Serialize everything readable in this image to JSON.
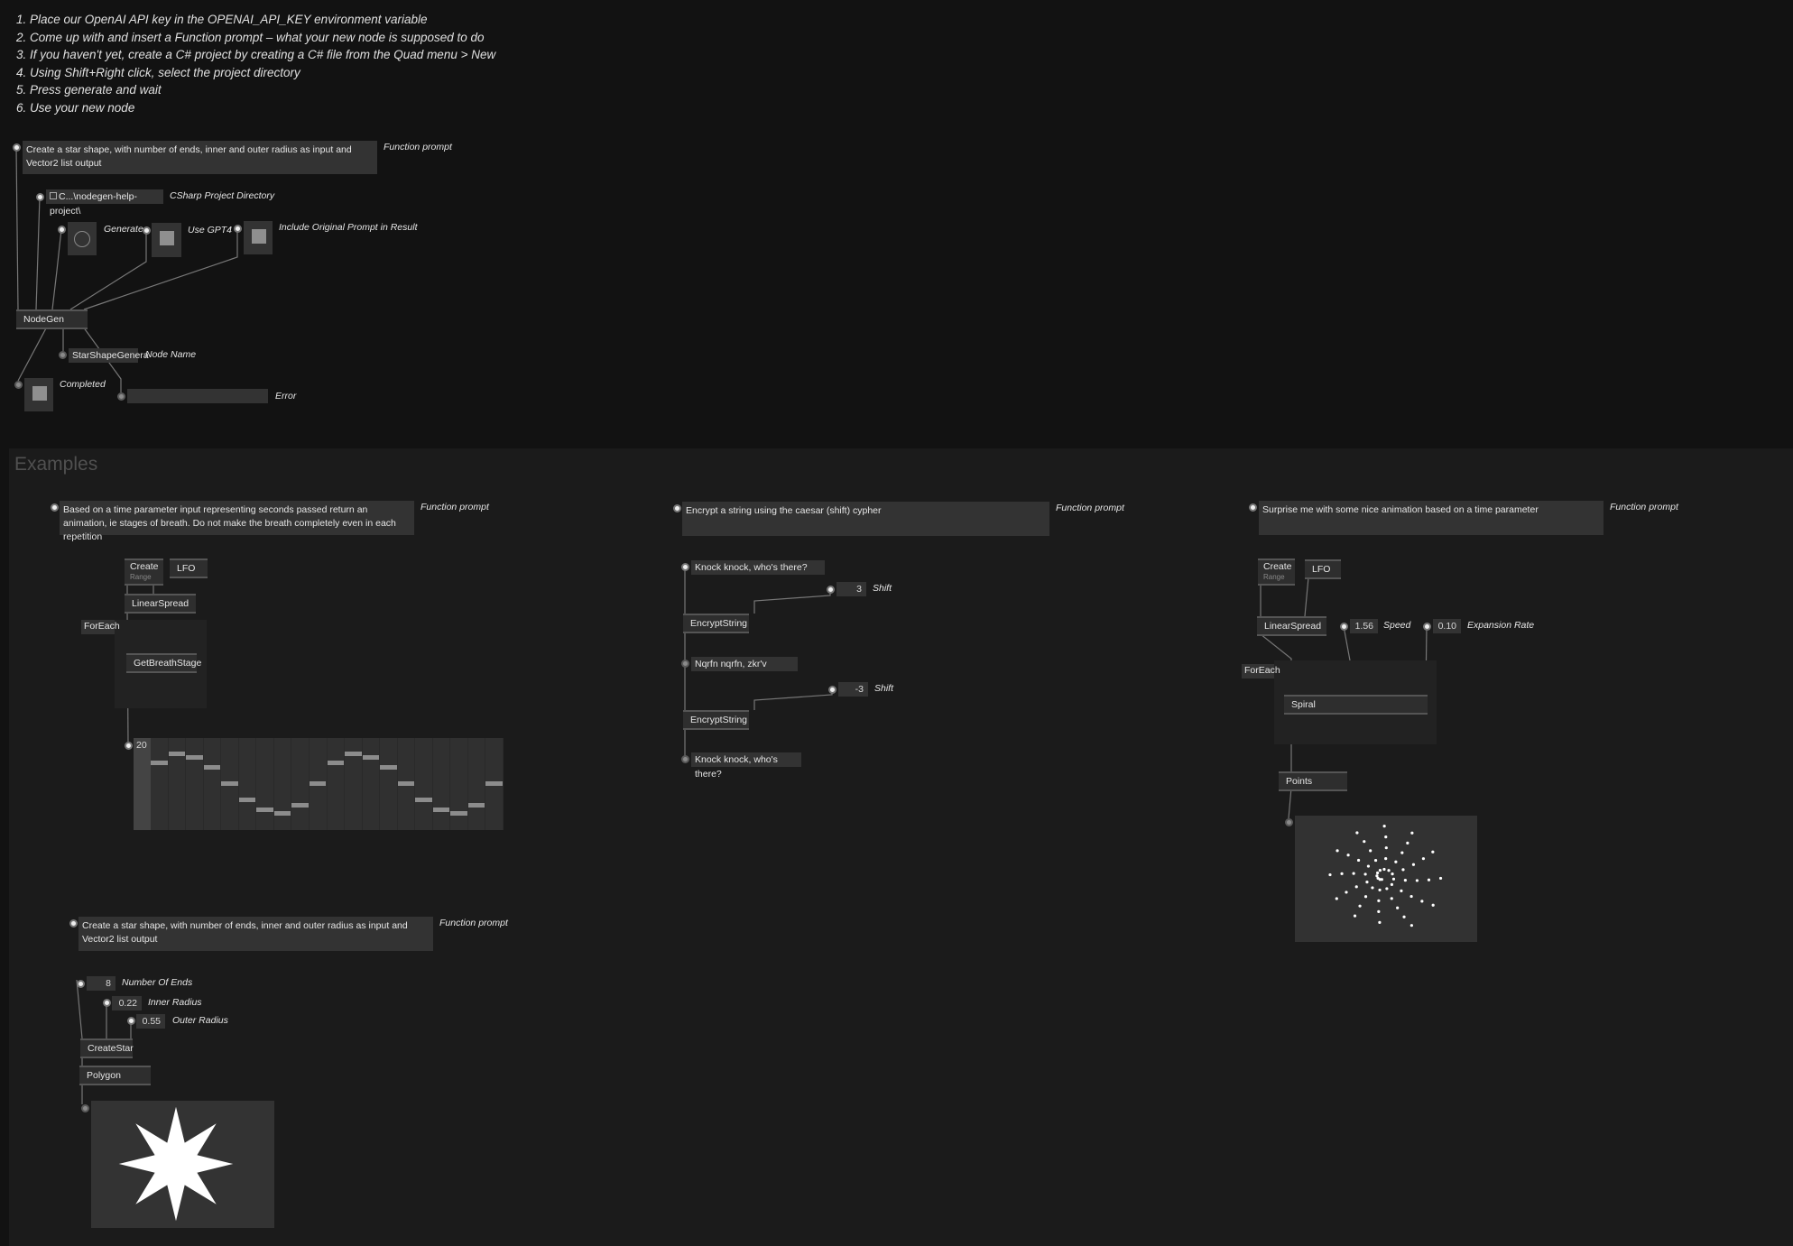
{
  "instructions": [
    "1. Place our OpenAI API key in the OPENAI_API_KEY environment variable",
    "2. Come up with and insert a Function prompt – what your new node is supposed to do",
    "3. If you haven't yet, create a C# project by creating a C# file from the Quad menu > New",
    "4. Using Shift+Right click, select the project directory",
    "5. Press generate and wait",
    "6. Use your new node"
  ],
  "nodegen": {
    "prompt": "Create a star shape, with number of ends, inner and outer radius as input and Vector2 list output",
    "prompt_label": "Function prompt",
    "directory": "C...\\nodegen-help-project\\",
    "directory_label": "CSharp Project Directory",
    "generate_label": "Generate",
    "gpt4_label": "Use GPT4",
    "include_label": "Include Original Prompt in Result",
    "node": "NodeGen",
    "node_name": "StarShapeGenera",
    "node_name_label": "Node Name",
    "completed_label": "Completed",
    "error_value": "",
    "error_label": "Error"
  },
  "examples_title": "Examples",
  "breath": {
    "prompt": "Based on a time parameter input representing seconds passed return an animation, ie stages of breath. Do not make the breath completely even in each repetition",
    "prompt_label": "Function prompt",
    "create": "Create",
    "range": "Range",
    "lfo": "LFO",
    "spread": "LinearSpread",
    "foreach": "ForEach",
    "node": "GetBreathStage",
    "count": "20",
    "values": [
      0.73,
      0.82,
      0.78,
      0.68,
      0.5,
      0.32,
      0.22,
      0.18,
      0.26,
      0.5,
      0.73,
      0.82,
      0.78,
      0.68,
      0.5,
      0.32,
      0.22,
      0.18,
      0.26,
      0.5
    ]
  },
  "caesar": {
    "prompt": "Encrypt a string using the caesar (shift) cypher",
    "prompt_label": "Function prompt",
    "input": "Knock knock, who's there?",
    "shift1": "3",
    "shift_label": "Shift",
    "node": "EncryptString",
    "encrypted": "Nqrfn nqrfn, zkr'v",
    "shift2": "-3",
    "decrypted": "Knock knock, who's there?"
  },
  "spiral": {
    "prompt": "Surprise me with some nice animation based on a time parameter",
    "prompt_label": "Function prompt",
    "create": "Create",
    "range": "Range",
    "lfo": "LFO",
    "spread": "LinearSpread",
    "speed": "1.56",
    "speed_label": "Speed",
    "rate": "0.10",
    "rate_label": "Expansion Rate",
    "foreach": "ForEach",
    "node": "Spiral",
    "points": "Points"
  },
  "star": {
    "prompt": "Create a star shape, with number of ends, inner and outer radius as input and Vector2 list output",
    "prompt_label": "Function prompt",
    "ends": "8",
    "ends_label": "Number Of Ends",
    "inner": "0.22",
    "inner_label": "Inner Radius",
    "outer": "0.55",
    "outer_label": "Outer Radius",
    "node": "CreateStar",
    "polygon": "Polygon"
  }
}
